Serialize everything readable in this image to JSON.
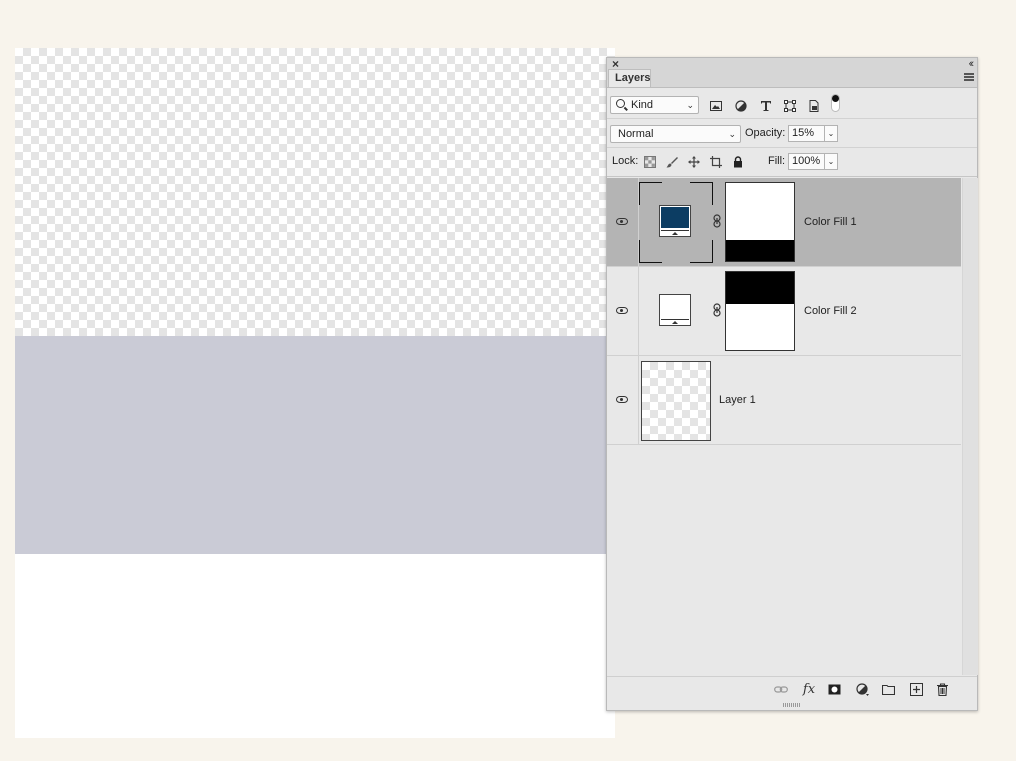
{
  "panel": {
    "tab_label": "Layers",
    "close_glyph": "×",
    "collapse_glyph": "‹‹",
    "filter": {
      "kind_label": "Kind",
      "icons": [
        "image-filter-icon",
        "adjustment-filter-icon",
        "type-filter-icon",
        "shape-filter-icon",
        "smart-object-filter-icon"
      ]
    },
    "blend_mode": "Normal",
    "opacity_label": "Opacity:",
    "opacity_value": "15%",
    "lock_label": "Lock:",
    "fill_label": "Fill:",
    "fill_value": "100%",
    "layers": [
      {
        "name": "Color Fill 1",
        "selected": true,
        "swatch_color": "#0c3d63"
      },
      {
        "name": "Color Fill 2",
        "selected": false,
        "swatch_color": "#ffffff"
      },
      {
        "name": "Layer 1",
        "selected": false
      }
    ],
    "bottom_icons": [
      "link-layers-icon",
      "fx-icon",
      "add-mask-icon",
      "new-adjustment-icon",
      "new-group-icon",
      "new-layer-icon",
      "delete-icon"
    ],
    "fx_glyph": "fx"
  },
  "canvas": {
    "band_color": "#cacbd6"
  }
}
